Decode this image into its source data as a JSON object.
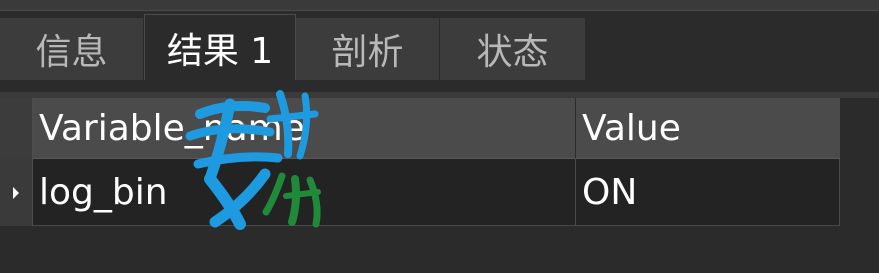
{
  "tabs": [
    {
      "label": "信息",
      "active": false
    },
    {
      "label": "结果 1",
      "active": true
    },
    {
      "label": "剖析",
      "active": false
    },
    {
      "label": "状态",
      "active": false
    }
  ],
  "grid": {
    "columns": [
      "Variable_name",
      "Value"
    ],
    "rows": [
      [
        "log_bin",
        "ON"
      ]
    ]
  },
  "colors": {
    "background": "#2b2b2b",
    "tab_inactive": "#3c3c3c",
    "header": "#4b4b4b",
    "cell": "#232323",
    "watermark_blue": "#1e9be0",
    "watermark_green": "#1f8a3a"
  }
}
